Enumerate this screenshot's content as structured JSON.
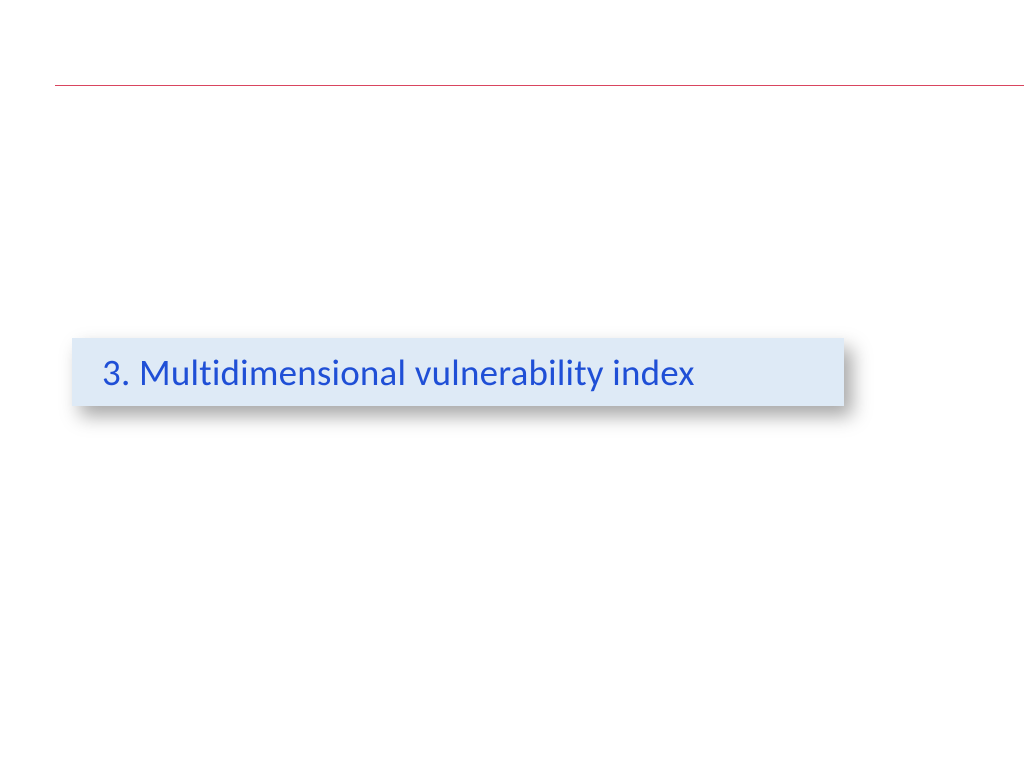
{
  "slide": {
    "section_title": "3. Multidimensional vulnerability index"
  }
}
